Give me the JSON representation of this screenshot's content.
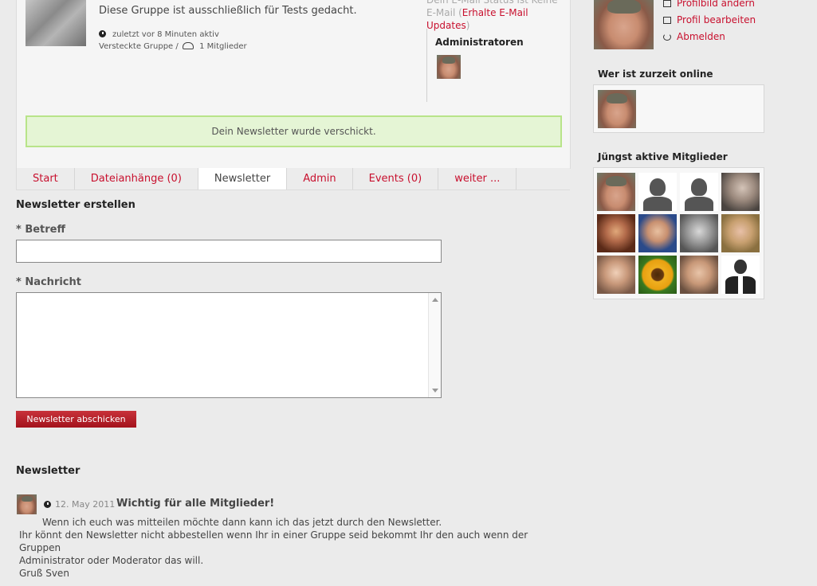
{
  "group": {
    "description": "Diese Gruppe ist ausschließlich für Tests gedacht.",
    "last_active": "zuletzt vor 8 Minuten aktiv",
    "visibility": "Versteckte Gruppe /",
    "members_count": "1 Mitglieder",
    "email_status_prefix": "Dein E-Mail Status ist Keine E-Mail (",
    "email_status_link": "Erhalte E-Mail Updates",
    "email_status_suffix": ")",
    "admins_title": "Administratoren"
  },
  "notice": "Dein Newsletter wurde verschickt.",
  "tabs": [
    {
      "label": "Start",
      "active": false
    },
    {
      "label": "Dateianhänge (0)",
      "active": false
    },
    {
      "label": "Newsletter",
      "active": true
    },
    {
      "label": "Admin",
      "active": false
    },
    {
      "label": "Events (0)",
      "active": false
    },
    {
      "label": "weiter ...",
      "active": false
    }
  ],
  "form": {
    "title": "Newsletter erstellen",
    "subject_label": "* Betreff",
    "subject_value": "",
    "message_label": "* Nachricht",
    "message_value": "",
    "submit_label": "Newsletter abschicken"
  },
  "newsletter_list": {
    "title": "Newsletter",
    "items": [
      {
        "date": "12. May 2011",
        "title": "Wichtig für alle Mitglieder!",
        "lines": [
          "Wenn ich euch was mitteilen möchte dann kann ich das jetzt durch den Newsletter.",
          "Ihr könnt den Newsletter nicht abbestellen wenn Ihr in einer Gruppe seid bekommt Ihr den auch wenn der Gruppen",
          "Administrator oder Moderator das will.",
          "Gruß Sven"
        ]
      }
    ]
  },
  "sidebar": {
    "profile_links": [
      {
        "label": "Profilbild ändern",
        "icon": "camera-icon"
      },
      {
        "label": "Profil bearbeiten",
        "icon": "edit-icon"
      },
      {
        "label": "Abmelden",
        "icon": "power-icon"
      }
    ],
    "online_title": "Wer ist zurzeit online",
    "members_title": "Jüngst aktive Mitglieder",
    "members": [
      "face-sven",
      "silhouette-f",
      "silhouette-f",
      "photo-oldman",
      "photo-woman-sun",
      "photo-man-blue",
      "photo-laugh",
      "photo-blonde",
      "photo-young",
      "photo-sunflower",
      "photo-boy",
      "photo-suit"
    ]
  },
  "colors": {
    "link": "#c8102e",
    "notice_bg": "#e5f5d5",
    "notice_border": "#b8e489",
    "button": "#b01c24",
    "page_bg": "#ebebeb"
  }
}
